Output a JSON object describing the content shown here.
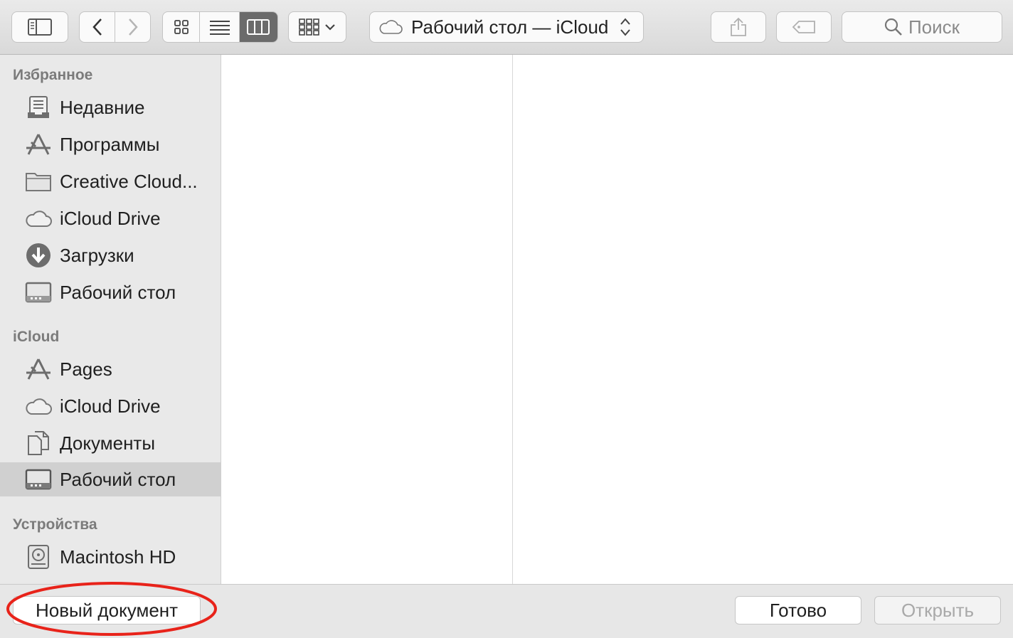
{
  "toolbar": {
    "path_label": "Рабочий стол — iCloud",
    "search_placeholder": "Поиск"
  },
  "sidebar": {
    "sections": [
      {
        "title": "Избранное",
        "items": [
          {
            "label": "Недавние",
            "icon": "recents-icon"
          },
          {
            "label": "Программы",
            "icon": "applications-icon"
          },
          {
            "label": "Creative Cloud...",
            "icon": "folder-icon"
          },
          {
            "label": "iCloud Drive",
            "icon": "cloud-icon"
          },
          {
            "label": "Загрузки",
            "icon": "downloads-icon"
          },
          {
            "label": "Рабочий стол",
            "icon": "desktop-icon"
          }
        ]
      },
      {
        "title": "iCloud",
        "items": [
          {
            "label": "Pages",
            "icon": "applications-icon"
          },
          {
            "label": "iCloud Drive",
            "icon": "cloud-icon"
          },
          {
            "label": "Документы",
            "icon": "documents-icon"
          },
          {
            "label": "Рабочий стол",
            "icon": "desktop-icon",
            "selected": true
          }
        ]
      },
      {
        "title": "Устройства",
        "items": [
          {
            "label": "Macintosh HD",
            "icon": "hard-drive-icon"
          }
        ]
      }
    ]
  },
  "footer": {
    "new_document": "Новый документ",
    "done": "Готово",
    "open": "Открыть"
  },
  "colors": {
    "annotation": "#e8231a",
    "selected_row": "#d0d0d0"
  }
}
